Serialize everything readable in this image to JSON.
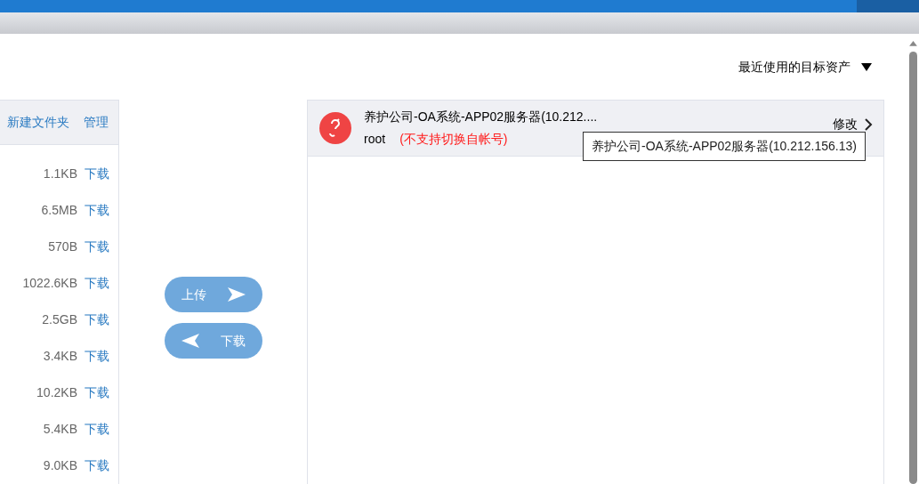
{
  "recent_assets": {
    "label": "最近使用的目标资产"
  },
  "local_panel": {
    "actions": [
      "新建文件夹",
      "管理"
    ],
    "files": [
      {
        "size": "1.1KB",
        "action": "下载"
      },
      {
        "size": "6.5MB",
        "action": "下载"
      },
      {
        "size": "570B",
        "action": "下载"
      },
      {
        "size": "1022.6KB",
        "action": "下载"
      },
      {
        "size": "2.5GB",
        "action": "下载"
      },
      {
        "size": "3.4KB",
        "action": "下载"
      },
      {
        "size": "10.2KB",
        "action": "下载"
      },
      {
        "size": "5.4KB",
        "action": "下载"
      },
      {
        "size": "9.0KB",
        "action": "下载"
      }
    ]
  },
  "transfer": {
    "upload": "上传",
    "download": "下载"
  },
  "target": {
    "name": "养护公司-OA系统-APP02服务器(10.212....",
    "account": "root",
    "note": "(不支持切换自帐号)",
    "edit": "修改",
    "tooltip": "养护公司-OA系统-APP02服务器(10.212.156.13)"
  }
}
